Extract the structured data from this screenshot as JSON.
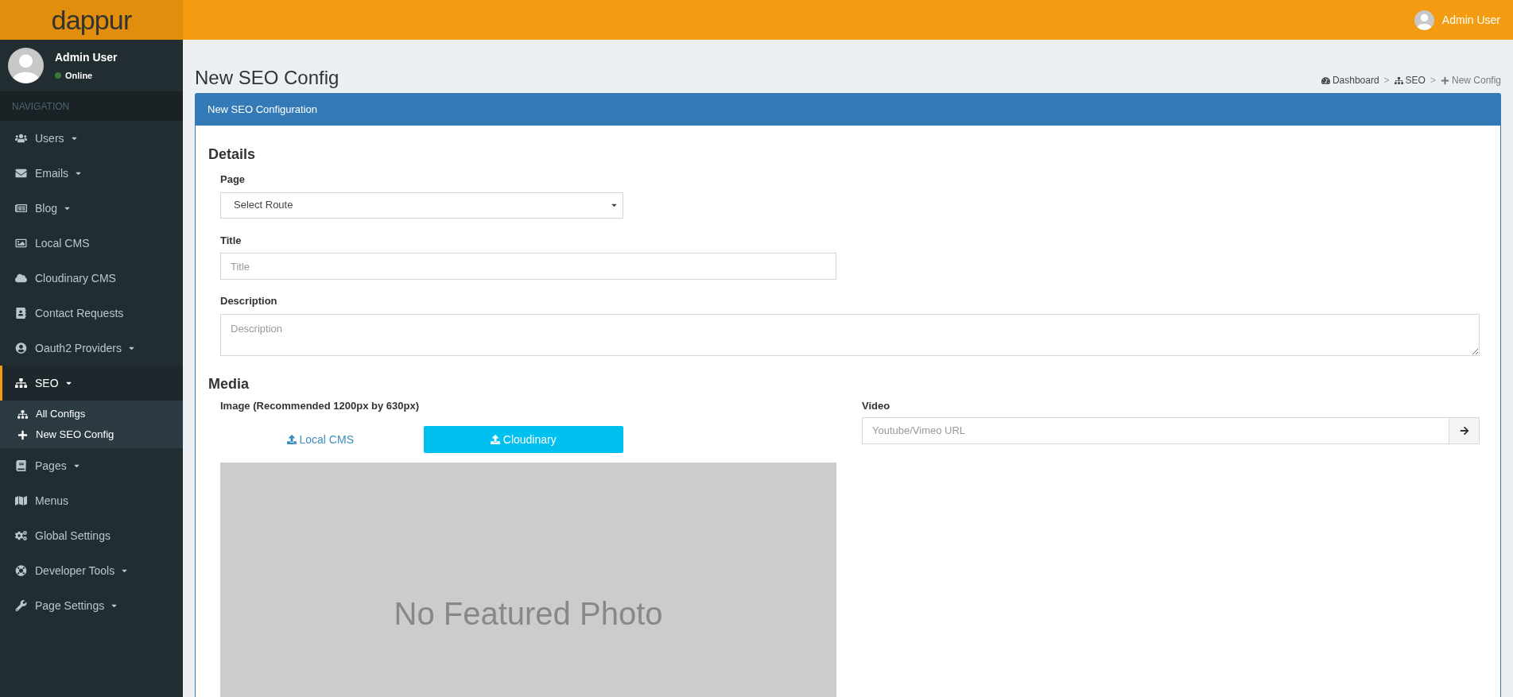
{
  "logo": "dappur",
  "header": {
    "user_name": "Admin User"
  },
  "user_panel": {
    "name": "Admin User",
    "status": "Online",
    "online": true
  },
  "sidebar": {
    "heading": "NAVIGATION",
    "items": [
      {
        "label": "Users",
        "caret": true,
        "selected": false
      },
      {
        "label": "Emails",
        "caret": true,
        "selected": false
      },
      {
        "label": "Blog",
        "caret": true,
        "selected": false
      },
      {
        "label": "Local CMS",
        "caret": false,
        "selected": false
      },
      {
        "label": "Cloudinary CMS",
        "caret": false,
        "selected": false
      },
      {
        "label": "Contact Requests",
        "caret": false,
        "selected": false
      },
      {
        "label": "Oauth2 Providers",
        "caret": true,
        "selected": false
      },
      {
        "label": "SEO",
        "caret": true,
        "selected": true,
        "expanded": true,
        "children": [
          {
            "label": "All Configs"
          },
          {
            "label": "New SEO Config"
          }
        ]
      },
      {
        "label": "Pages",
        "caret": true,
        "selected": false
      },
      {
        "label": "Menus",
        "caret": false,
        "selected": false
      },
      {
        "label": "Global Settings",
        "caret": false,
        "selected": false
      },
      {
        "label": "Developer Tools",
        "caret": true,
        "selected": false
      },
      {
        "label": "Page Settings",
        "caret": true,
        "selected": false
      }
    ]
  },
  "page_title": "New SEO Config",
  "breadcrumb": [
    {
      "label": "Dashboard",
      "active": false
    },
    {
      "label": "SEO",
      "active": false
    },
    {
      "label": "New Config",
      "active": true
    }
  ],
  "breadcrumb_separator": ">",
  "box": {
    "title": "New SEO Configuration",
    "details": {
      "heading": "Details",
      "page": {
        "label": "Page",
        "value": "Select Route"
      },
      "title": {
        "label": "Title",
        "placeholder": "Title"
      },
      "description": {
        "label": "Description",
        "placeholder": "Description"
      }
    },
    "media": {
      "heading": "Media",
      "image": {
        "label": "Image (Recommended 1200px by 630px)",
        "sources": [
          {
            "label": "Local CMS",
            "selected": false
          },
          {
            "label": "Cloudinary",
            "selected": true
          }
        ],
        "placeholder_text": "No Featured Photo"
      },
      "video": {
        "label": "Video",
        "placeholder": "Youtube/Vimeo URL"
      }
    }
  }
}
